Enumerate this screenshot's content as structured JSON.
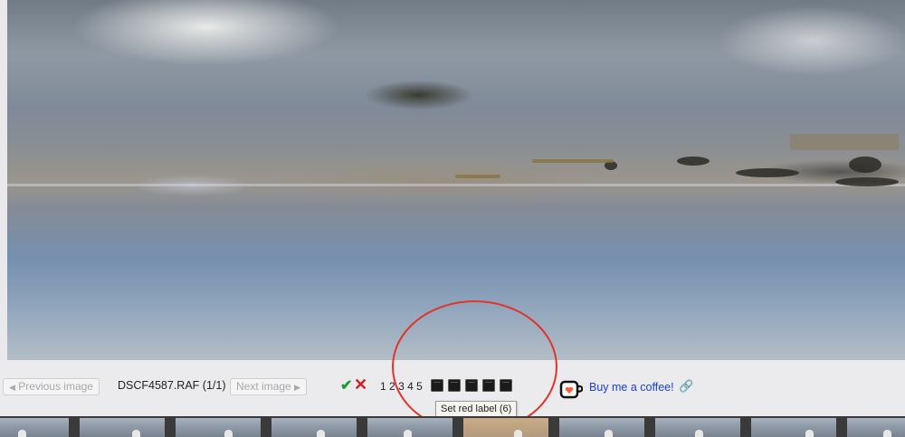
{
  "viewer": {
    "prev_label": "Previous image",
    "prev_arrow": "◀",
    "filename": "DSCF4587.RAF (1/1)",
    "next_label": "Next image",
    "next_arrow": "▶"
  },
  "rating": {
    "accept_icon": "✔",
    "reject_icon": "✕",
    "stars": [
      "1",
      "2",
      "3",
      "4",
      "5"
    ]
  },
  "color_labels": {
    "count": 5,
    "tooltip": "Set red label (6)"
  },
  "support": {
    "coffee_icon": "coffee-cup-icon",
    "link_text": "Buy me a coffee!",
    "external_icon": "🔗"
  },
  "colors": {
    "accept": "#1f9b3a",
    "reject": "#d01f1f",
    "link": "#1a3fd6",
    "annotation": "#e0352b"
  },
  "filmstrip": {
    "thumb_count": 10
  }
}
